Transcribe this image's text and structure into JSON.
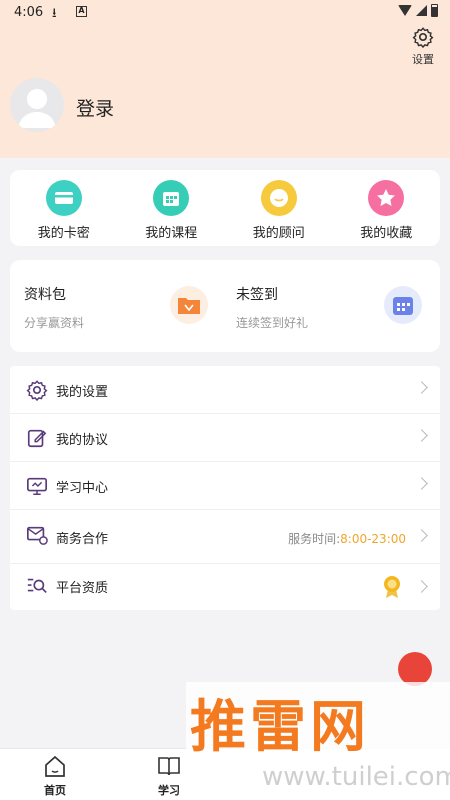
{
  "status_bar": {
    "time": "4:06",
    "a_icon": "A"
  },
  "header": {
    "settings_label": "设置",
    "login_label": "登录"
  },
  "quick_actions": [
    {
      "label": "我的卡密",
      "icon": "card-icon",
      "color": "#3ed1c3"
    },
    {
      "label": "我的课程",
      "icon": "calendar-icon",
      "color": "#35cdb5"
    },
    {
      "label": "我的顾问",
      "icon": "smile-icon",
      "color": "#f7c93c"
    },
    {
      "label": "我的收藏",
      "icon": "star-icon",
      "color": "#f66fa1"
    }
  ],
  "promo": {
    "left": {
      "title": "资料包",
      "subtitle": "分享赢资料",
      "icon": "folder-icon",
      "color": "#f3863a"
    },
    "right": {
      "title": "未签到",
      "subtitle": "连续签到好礼",
      "icon": "calendar-checkin-icon",
      "color": "#6b83e8"
    }
  },
  "menu": [
    {
      "label": "我的设置",
      "icon": "gear-icon"
    },
    {
      "label": "我的协议",
      "icon": "edit-icon"
    },
    {
      "label": "学习中心",
      "icon": "monitor-icon"
    },
    {
      "label": "商务合作",
      "icon": "mail-icon",
      "extra_prefix": "服务时间:",
      "extra_value": "8:00-23:00"
    },
    {
      "label": "平台资质",
      "icon": "search-list-icon",
      "badge": "medal-icon"
    }
  ],
  "tabs": [
    {
      "label": "首页",
      "icon": "home-icon"
    },
    {
      "label": "学习",
      "icon": "book-icon"
    }
  ],
  "watermark": {
    "title": "推雷网",
    "url": "www.tuilei.com"
  },
  "colors": {
    "header_bg": "#fde7d9",
    "accent_orange": "#f0a52a",
    "page_bg": "#f3f3f5"
  }
}
